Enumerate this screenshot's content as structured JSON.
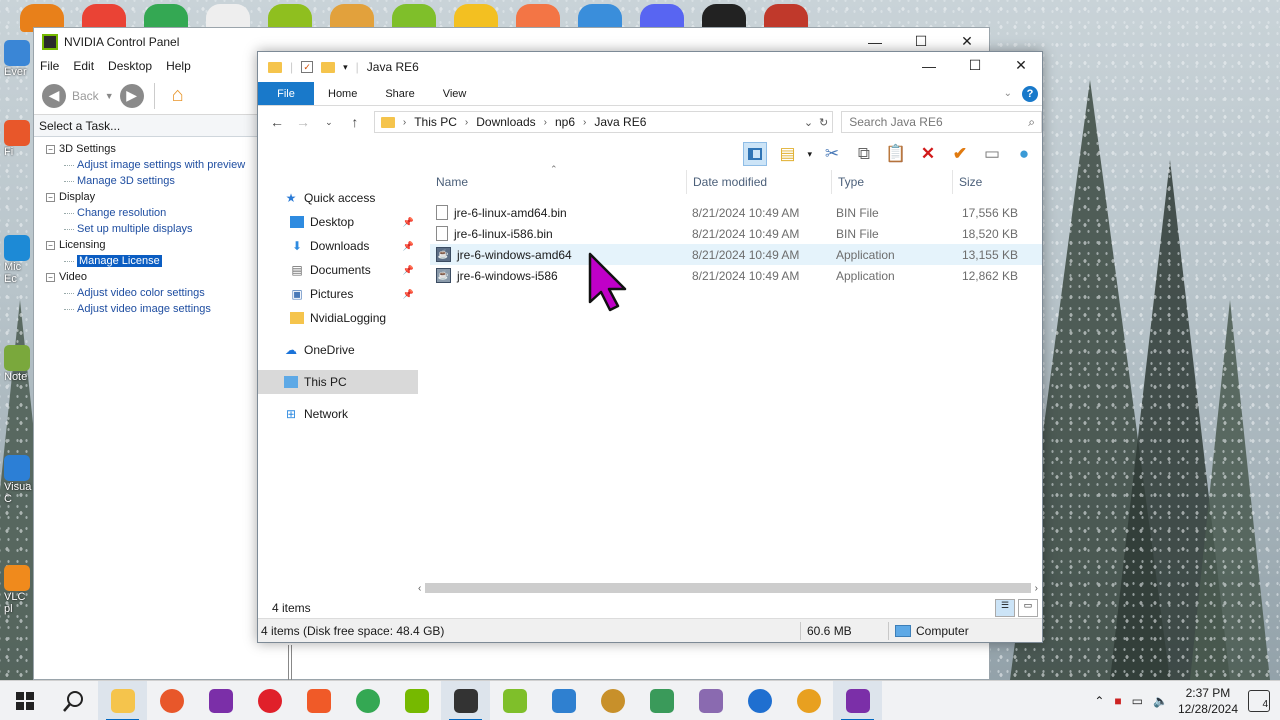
{
  "colors": {
    "accent": "#1979ca",
    "nvidia_green": "#76b900",
    "selection": "#0b5dc2",
    "cursor": "#c000c8"
  },
  "nvidia": {
    "title": "NVIDIA Control Panel",
    "menu": [
      "File",
      "Edit",
      "Desktop",
      "Help"
    ],
    "back_label": "Back",
    "task_header": "Select a Task...",
    "tree": [
      {
        "label": "3D Settings",
        "items": [
          "Adjust image settings with preview",
          "Manage 3D settings"
        ]
      },
      {
        "label": "Display",
        "items": [
          "Change resolution",
          "Set up multiple displays"
        ]
      },
      {
        "label": "Licensing",
        "items": [
          "Manage License"
        ]
      },
      {
        "label": "Video",
        "items": [
          "Adjust video color settings",
          "Adjust video image settings"
        ]
      }
    ]
  },
  "explorer": {
    "title": "Java RE6",
    "ribbon_tabs": [
      "File",
      "Home",
      "Share",
      "View"
    ],
    "breadcrumb": [
      "This PC",
      "Downloads",
      "np6",
      "Java RE6"
    ],
    "search_placeholder": "Search Java RE6",
    "nav": {
      "quick_access": "Quick access",
      "quick_items": [
        "Desktop",
        "Downloads",
        "Documents",
        "Pictures",
        "NvidiaLogging"
      ],
      "onedrive": "OneDrive",
      "this_pc": "This PC",
      "network": "Network"
    },
    "columns": [
      "Name",
      "Date modified",
      "Type",
      "Size"
    ],
    "files": [
      {
        "name": "jre-6-linux-amd64.bin",
        "date": "8/21/2024 10:49 AM",
        "type": "BIN File",
        "size": "17,556 KB"
      },
      {
        "name": "jre-6-linux-i586.bin",
        "date": "8/21/2024 10:49 AM",
        "type": "BIN File",
        "size": "18,520 KB"
      },
      {
        "name": "jre-6-windows-amd64",
        "date": "8/21/2024 10:49 AM",
        "type": "Application",
        "size": "13,155 KB"
      },
      {
        "name": "jre-6-windows-i586",
        "date": "8/21/2024 10:49 AM",
        "type": "Application",
        "size": "12,862 KB"
      }
    ],
    "item_count": "4 items",
    "status_left": "4 items (Disk free space: 48.4 GB)",
    "status_size": "60.6 MB",
    "status_location": "Computer"
  },
  "desktop_labels": [
    "Ever",
    "Fi",
    "Mic",
    "Ec",
    "Note",
    "Visua",
    "C",
    "VLC",
    "pl"
  ],
  "taskbar": {
    "time": "2:37 PM",
    "date": "12/28/2024",
    "notifications": "4"
  }
}
